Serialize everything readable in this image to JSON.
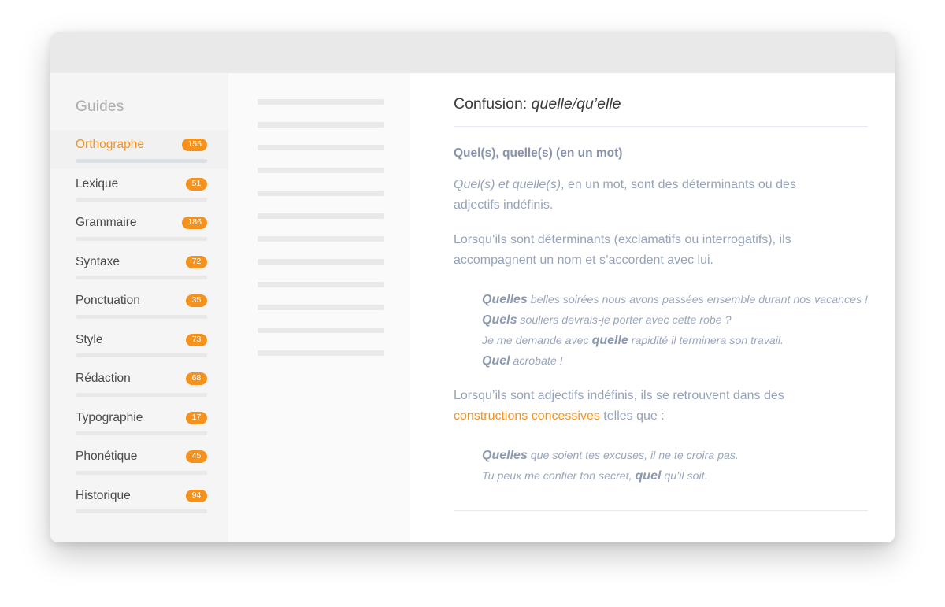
{
  "window": {
    "traffic_lights": [
      "close-dot",
      "minimize-dot",
      "maximize-dot"
    ]
  },
  "sidebar": {
    "title": "Guides",
    "items": [
      {
        "label": "Orthographe",
        "count": "155",
        "active": true
      },
      {
        "label": "Lexique",
        "count": "51",
        "active": false
      },
      {
        "label": "Grammaire",
        "count": "186",
        "active": false
      },
      {
        "label": "Syntaxe",
        "count": "72",
        "active": false
      },
      {
        "label": "Ponctuation",
        "count": "35",
        "active": false
      },
      {
        "label": "Style",
        "count": "73",
        "active": false
      },
      {
        "label": "Rédaction",
        "count": "68",
        "active": false
      },
      {
        "label": "Typographie",
        "count": "17",
        "active": false
      },
      {
        "label": "Phonétique",
        "count": "45",
        "active": false
      },
      {
        "label": "Historique",
        "count": "94",
        "active": false
      }
    ]
  },
  "middle_column": {
    "placeholder_bar_count": 12
  },
  "article": {
    "title_prefix": "Confusion: ",
    "title_italic": "quelle/qu’elle",
    "subheading": "Quel(s), quelle(s) (en un mot)",
    "paragraph1_italic": "Quel(s) et quelle(s)",
    "paragraph1_rest": ", en un mot, sont des déterminants ou des adjectifs indéfinis.",
    "paragraph2": "Lorsqu’ils sont déterminants (exclamatifs ou interrogatifs), ils accompagnent un nom et s’accordent avec lui.",
    "examples1": [
      {
        "pre": "",
        "em": "Quelles",
        "post": " belles soirées nous avons passées ensemble durant nos vacances !"
      },
      {
        "pre": "",
        "em": "Quels",
        "post": " souliers devrais-je porter avec cette robe ?"
      },
      {
        "pre": "Je me demande avec ",
        "em": "quelle",
        "post": " rapidité il terminera son travail."
      },
      {
        "pre": "",
        "em": "Quel",
        "post": " acrobate !"
      }
    ],
    "paragraph3_pre": "Lorsqu’ils sont adjectifs indéfinis, ils se retrouvent dans des ",
    "paragraph3_link": "constructions concessives",
    "paragraph3_post": " telles que :",
    "examples2": [
      {
        "pre": "",
        "em": "Quelles",
        "post": " que soient tes excuses, il ne te croira pas."
      },
      {
        "pre": "Tu peux me confier ton secret, ",
        "em": "quel",
        "post": " qu’il soit."
      }
    ]
  },
  "colors": {
    "accent_orange": "#f5921e",
    "body_text": "#97a3b8",
    "heading_text": "#3b3b3b",
    "sidebar_bg": "#f5f5f5",
    "middle_bg": "#fafafa"
  }
}
